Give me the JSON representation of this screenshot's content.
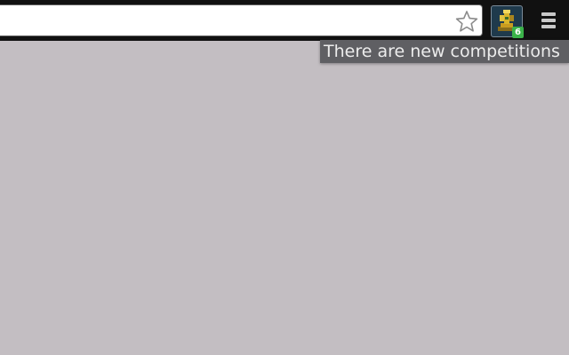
{
  "extension": {
    "badge_count": "6",
    "tooltip": "There are new competitions",
    "icon": "trophy-icon",
    "badge_color": "#3bb34a"
  },
  "toolbar": {
    "bookmark_icon": "star-icon",
    "menu_icon": "hamburger-menu-icon"
  },
  "colors": {
    "toolbar_bg": "#111111",
    "page_bg": "#c3bec2"
  }
}
